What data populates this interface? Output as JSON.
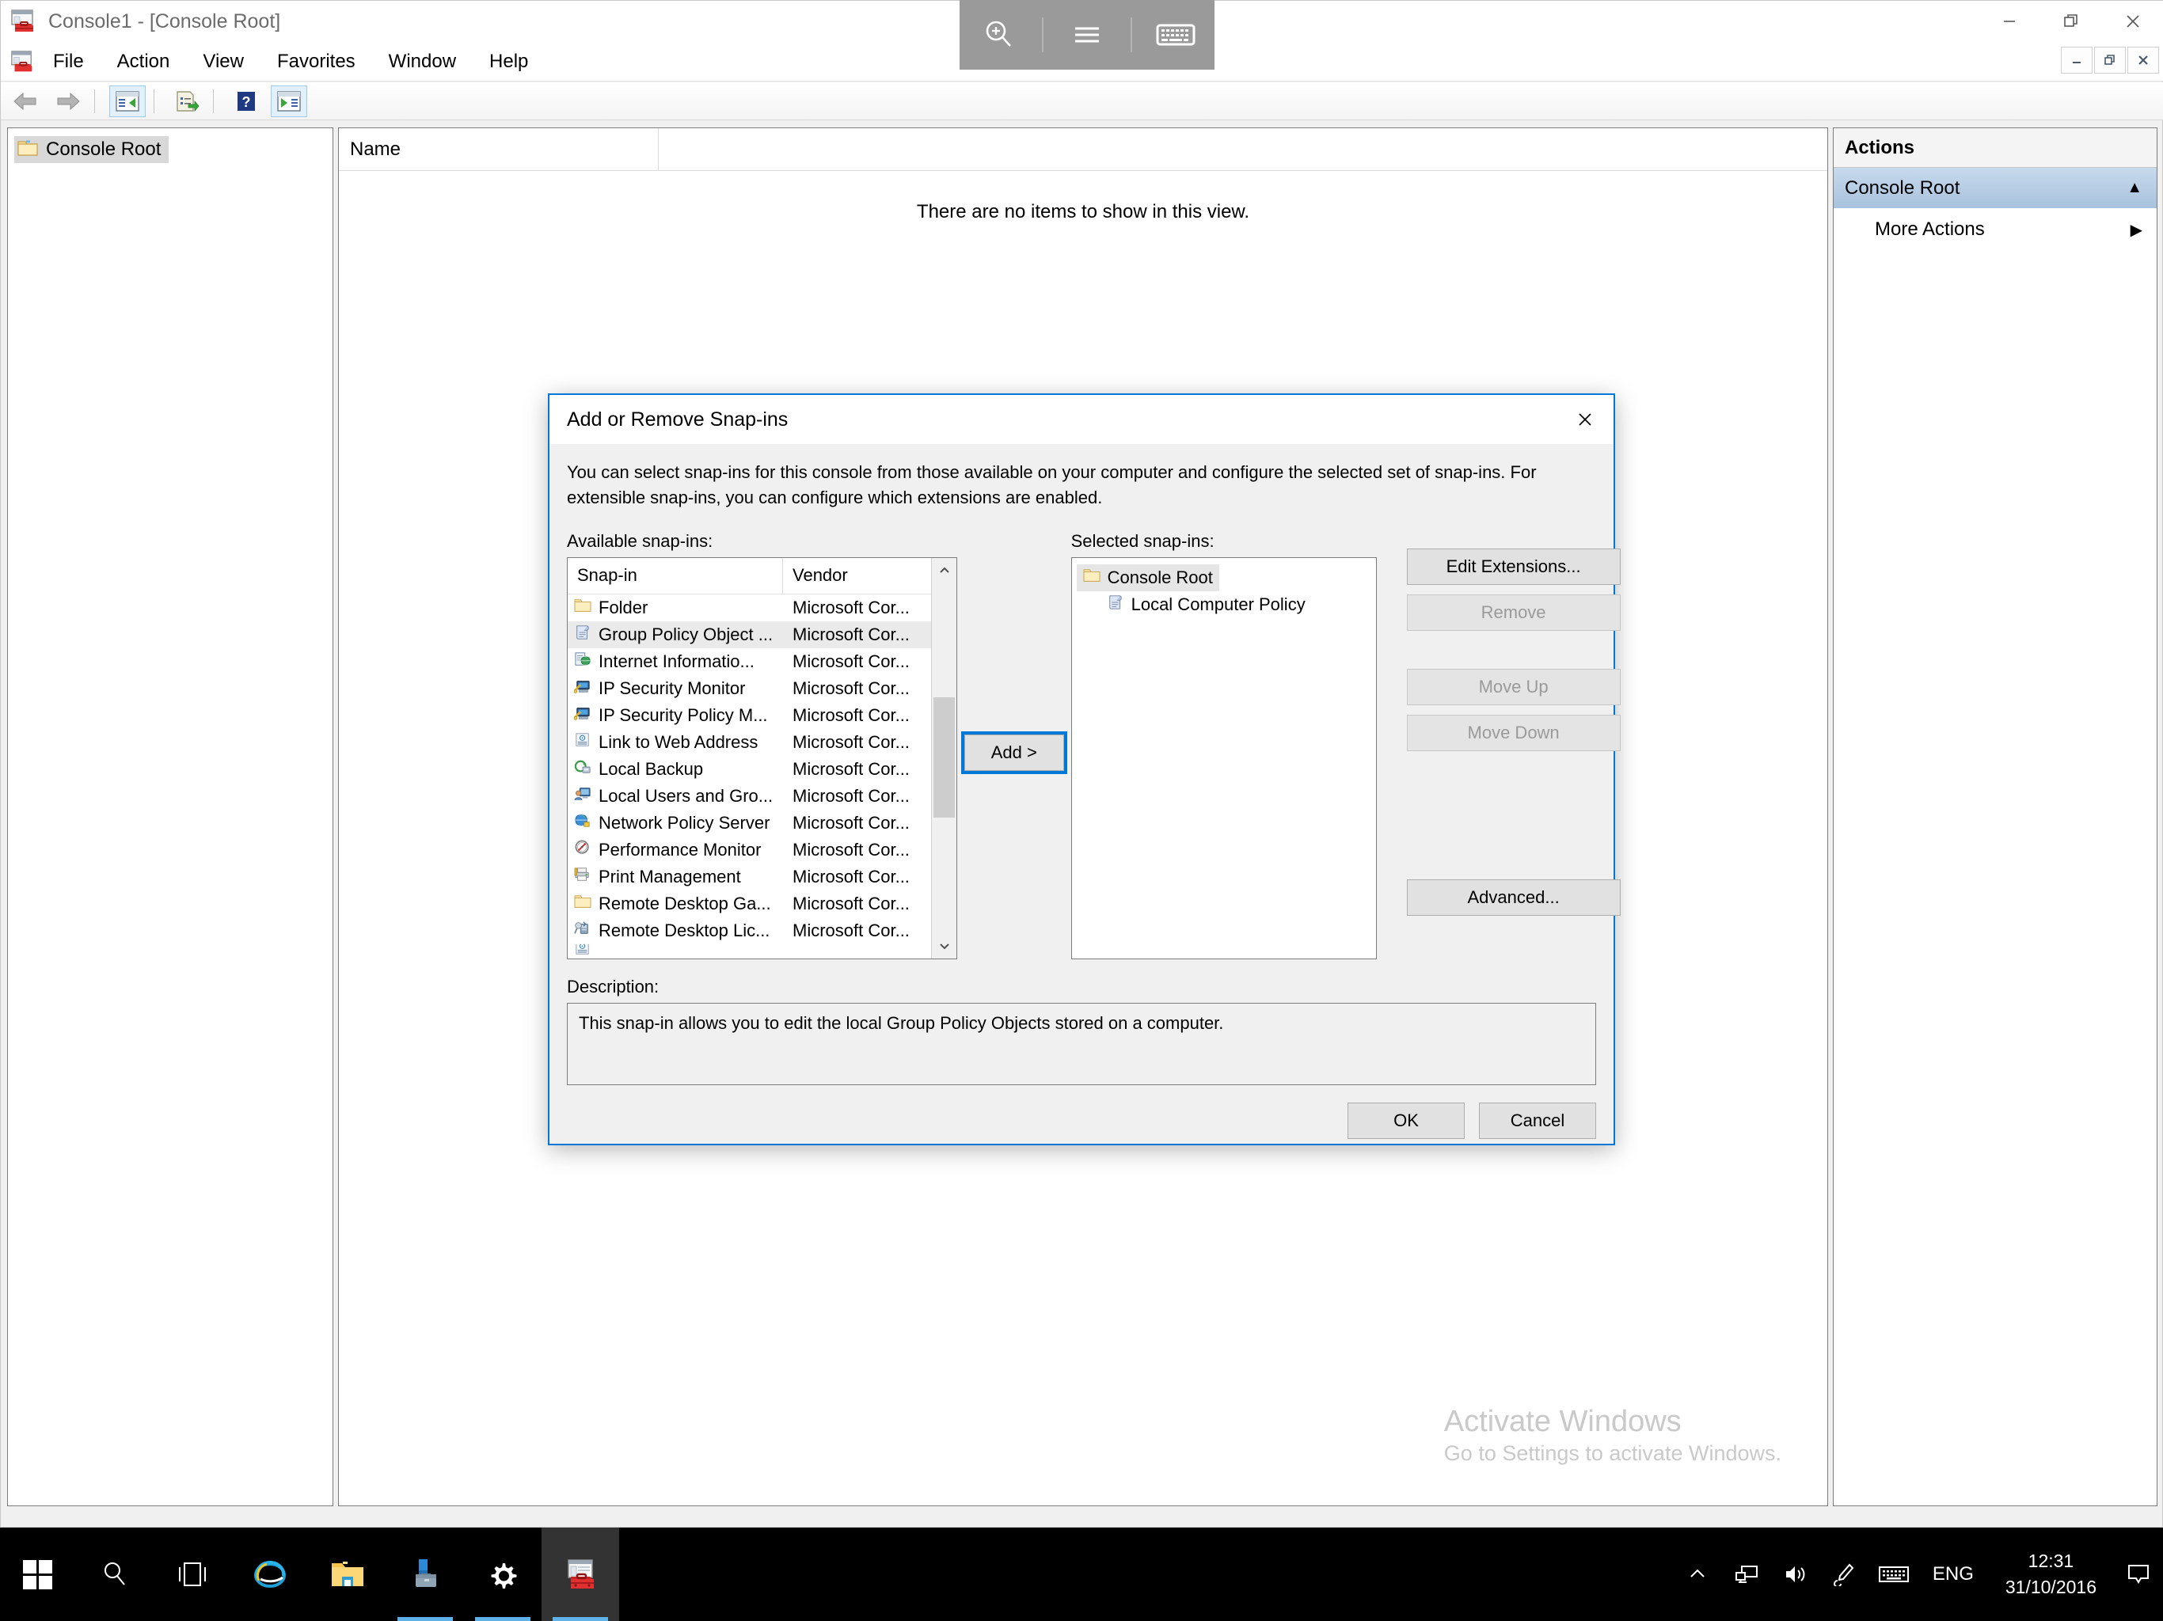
{
  "window": {
    "title": "Console1 - [Console Root]",
    "app_icon": "mmc-console-icon",
    "minimize_label": "—",
    "restore_label": "❐",
    "close_label": "✕"
  },
  "menubar": {
    "items": [
      {
        "label": "File",
        "name": "menu-file"
      },
      {
        "label": "Action",
        "name": "menu-action"
      },
      {
        "label": "View",
        "name": "menu-view"
      },
      {
        "label": "Favorites",
        "name": "menu-favorites"
      },
      {
        "label": "Window",
        "name": "menu-window"
      },
      {
        "label": "Help",
        "name": "menu-help"
      }
    ],
    "inner_controls": {
      "minimize": "–",
      "restore": "❐",
      "close": "✕"
    }
  },
  "toolbar": {
    "buttons": [
      {
        "name": "back-arrow-icon",
        "label": "Back"
      },
      {
        "name": "forward-arrow-icon",
        "label": "Forward"
      },
      {
        "name": "show-hide-console-tree-icon",
        "label": "Show/Hide Console Tree"
      },
      {
        "name": "export-list-icon",
        "label": "Export List"
      },
      {
        "name": "help-icon",
        "label": "Help"
      },
      {
        "name": "show-hide-action-pane-icon",
        "label": "Show/Hide Action Pane"
      }
    ]
  },
  "tree_pane": {
    "root_label": "Console Root",
    "root_icon": "folder-icon"
  },
  "result_pane": {
    "column_header": "Name",
    "empty_message": "There are no items to show in this view."
  },
  "watermark": {
    "title": "Activate Windows",
    "subtitle": "Go to Settings to activate Windows."
  },
  "actions_pane": {
    "header": "Actions",
    "group_label": "Console Root",
    "group_chevron": "▲",
    "items": [
      {
        "label": "More Actions",
        "chevron": "▶"
      }
    ]
  },
  "magnifier_toolbar": {
    "buttons": [
      {
        "name": "magnifier-zoom-in-icon",
        "label": "Zoom in"
      },
      {
        "name": "magnifier-menu-icon",
        "label": "Magnifier options"
      },
      {
        "name": "on-screen-keyboard-icon",
        "label": "On-screen keyboard"
      }
    ]
  },
  "dialog": {
    "title": "Add or Remove Snap-ins",
    "close_label": "✕",
    "intro": "You can select snap-ins for this console from those available on your computer and configure the selected set of snap-ins. For extensible snap-ins, you can configure which extensions are enabled.",
    "available_label": "Available snap-ins:",
    "selected_label": "Selected snap-ins:",
    "available_columns": {
      "snapin": "Snap-in",
      "vendor": "Vendor"
    },
    "available_items": [
      {
        "name": "Folder",
        "vendor": "Microsoft Cor...",
        "icon": "folder-icon",
        "selected": false
      },
      {
        "name": "Group Policy Object ...",
        "vendor": "Microsoft Cor...",
        "icon": "policy-scroll-icon",
        "selected": true
      },
      {
        "name": "Internet Informatio...",
        "vendor": "Microsoft Cor...",
        "icon": "iis-globe-icon",
        "selected": false
      },
      {
        "name": "IP Security Monitor",
        "vendor": "Microsoft Cor...",
        "icon": "ipsec-monitor-icon",
        "selected": false
      },
      {
        "name": "IP Security Policy M...",
        "vendor": "Microsoft Cor...",
        "icon": "ipsec-policy-icon",
        "selected": false
      },
      {
        "name": "Link to Web Address",
        "vendor": "Microsoft Cor...",
        "icon": "web-link-icon",
        "selected": false
      },
      {
        "name": "Local Backup",
        "vendor": "Microsoft Cor...",
        "icon": "backup-icon",
        "selected": false
      },
      {
        "name": "Local Users and Gro...",
        "vendor": "Microsoft Cor...",
        "icon": "users-groups-icon",
        "selected": false
      },
      {
        "name": "Network Policy Server",
        "vendor": "Microsoft Cor...",
        "icon": "network-policy-icon",
        "selected": false
      },
      {
        "name": "Performance Monitor",
        "vendor": "Microsoft Cor...",
        "icon": "performance-monitor-icon",
        "selected": false
      },
      {
        "name": "Print Management",
        "vendor": "Microsoft Cor...",
        "icon": "printer-icon",
        "selected": false
      },
      {
        "name": "Remote Desktop Ga...",
        "vendor": "Microsoft Cor...",
        "icon": "folder-icon",
        "selected": false
      },
      {
        "name": "Remote Desktop Lic...",
        "vendor": "Microsoft Cor...",
        "icon": "rd-licensing-icon",
        "selected": false
      }
    ],
    "add_button": "Add >",
    "selected_items": [
      {
        "label": "Console Root",
        "icon": "folder-icon",
        "level": 0,
        "selected": true
      },
      {
        "label": "Local Computer Policy",
        "icon": "policy-scroll-icon",
        "level": 1,
        "selected": false
      }
    ],
    "side_buttons": [
      {
        "label": "Edit Extensions...",
        "disabled": false
      },
      {
        "label": "Remove",
        "disabled": true
      },
      {
        "label": "Move Up",
        "disabled": true
      },
      {
        "label": "Move Down",
        "disabled": true
      },
      {
        "label": "Advanced...",
        "disabled": false
      }
    ],
    "description_label": "Description:",
    "description_text": "This snap-in allows you to edit the local Group Policy Objects stored on a computer.",
    "ok_label": "OK",
    "cancel_label": "Cancel"
  },
  "taskbar": {
    "items": [
      {
        "name": "start-button",
        "icon": "windows-logo-icon"
      },
      {
        "name": "search-button",
        "icon": "search-icon"
      },
      {
        "name": "task-view-button",
        "icon": "task-view-icon"
      },
      {
        "name": "internet-explorer-button",
        "icon": "internet-explorer-icon"
      },
      {
        "name": "file-explorer-button",
        "icon": "file-explorer-icon"
      },
      {
        "name": "server-manager-button",
        "icon": "server-manager-icon"
      },
      {
        "name": "settings-button",
        "icon": "gear-icon"
      },
      {
        "name": "mmc-console-button",
        "icon": "mmc-console-icon"
      }
    ],
    "tray": {
      "show_hidden": "∧",
      "network_icon": "network-icon",
      "volume_icon": "volume-icon",
      "pen_icon": "pen-icon",
      "keyboard_icon": "keyboard-icon",
      "language": "ENG",
      "time": "12:31",
      "date": "31/10/2016",
      "action_center_icon": "action-center-icon"
    }
  },
  "colors": {
    "accent": "#0078d7",
    "dialog_border": "#0078d7",
    "actions_group": "#a8c2dd",
    "taskbar_bg": "#000000",
    "watermark": "#c9c9c9"
  }
}
